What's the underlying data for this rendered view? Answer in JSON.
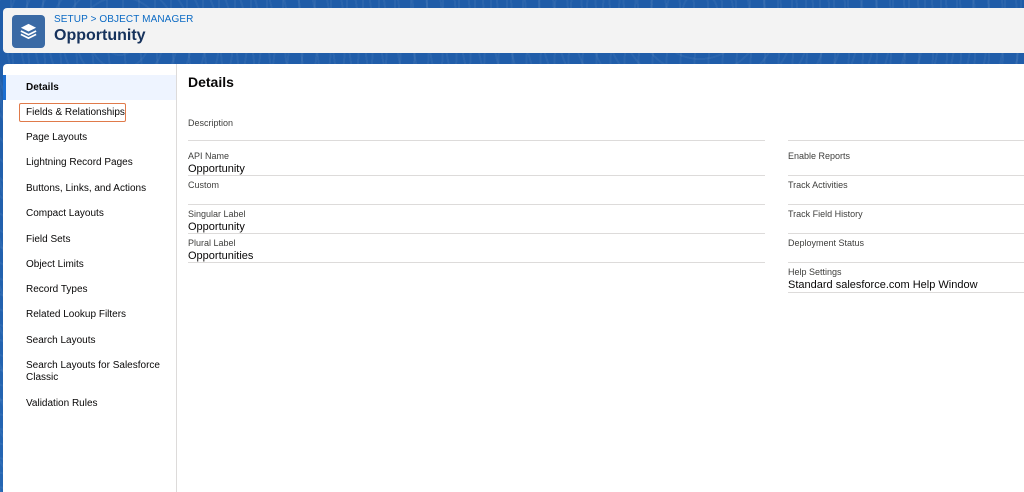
{
  "header": {
    "breadcrumb_setup": "SETUP",
    "breadcrumb_separator": ">",
    "breadcrumb_object_manager": "OBJECT MANAGER",
    "title": "Opportunity",
    "icon": "layers-icon"
  },
  "sidebar": {
    "items": [
      {
        "label": "Details",
        "active": true
      },
      {
        "label": "Fields & Relationships",
        "highlighted": true
      },
      {
        "label": "Page Layouts"
      },
      {
        "label": "Lightning Record Pages"
      },
      {
        "label": "Buttons, Links, and Actions"
      },
      {
        "label": "Compact Layouts"
      },
      {
        "label": "Field Sets"
      },
      {
        "label": "Object Limits"
      },
      {
        "label": "Record Types"
      },
      {
        "label": "Related Lookup Filters"
      },
      {
        "label": "Search Layouts"
      },
      {
        "label": "Search Layouts for Salesforce Classic"
      },
      {
        "label": "Validation Rules"
      }
    ]
  },
  "main": {
    "title": "Details",
    "left_fields": [
      {
        "label": "Description",
        "value": ""
      },
      {
        "label": "API Name",
        "value": "Opportunity"
      },
      {
        "label": "Custom",
        "value": ""
      },
      {
        "label": "Singular Label",
        "value": "Opportunity"
      },
      {
        "label": "Plural Label",
        "value": "Opportunities"
      }
    ],
    "right_fields": [
      {
        "label": "Enable Reports",
        "value": ""
      },
      {
        "label": "Track Activities",
        "value": ""
      },
      {
        "label": "Track Field History",
        "value": ""
      },
      {
        "label": "Deployment Status",
        "value": ""
      },
      {
        "label": "Help Settings",
        "value": "Standard salesforce.com Help Window"
      }
    ]
  },
  "colors": {
    "brand_blue": "#1b5297",
    "link_blue": "#0b6ac4",
    "active_border": "#1b6ed1",
    "highlight_orange": "#e07a4a"
  }
}
